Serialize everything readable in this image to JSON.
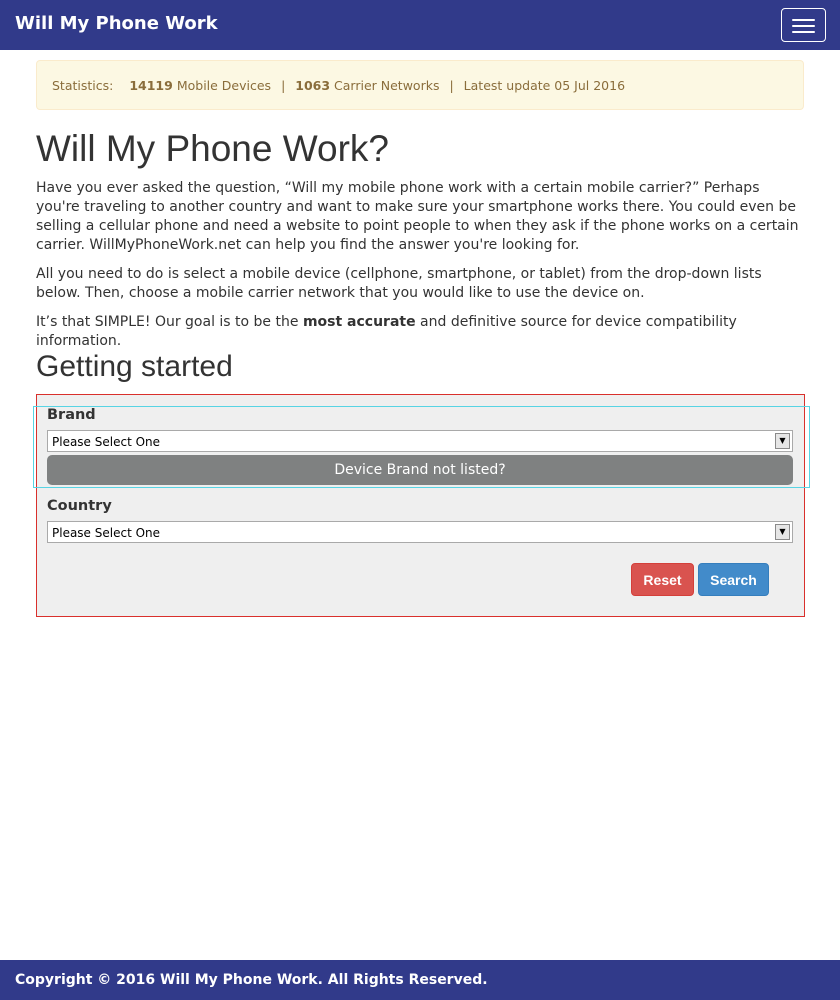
{
  "nav": {
    "brand": "Will My Phone Work"
  },
  "stats": {
    "label": "Statistics:",
    "devices_count": "14119",
    "devices_label": "Mobile Devices",
    "separator": "|",
    "networks_count": "1063",
    "networks_label": "Carrier Networks",
    "update_text": "Latest update 05 Jul 2016"
  },
  "main": {
    "title": "Will My Phone Work?",
    "paragraph1": "Have you ever asked the question, “Will my mobile phone work with a certain mobile carrier?” Perhaps you're traveling to another country and want to make sure your smartphone works there. You could even be selling a cellular phone and need a website to point people to when they ask if the phone works on a certain carrier. WillMyPhoneWork.net can help you find the answer you're looking for.",
    "paragraph2": "All you need to do is select a mobile device (cellphone, smartphone, or tablet) from the drop-down lists below. Then, choose a mobile carrier network that you would like to use the device on.",
    "paragraph3_before": "It’s that SIMPLE! Our goal is to be the ",
    "paragraph3_bold": "most accurate",
    "paragraph3_after": " and definitive source for device compatibility information.",
    "section_title": "Getting started"
  },
  "form": {
    "brand_label": "Brand",
    "brand_selected": "Please Select One",
    "brand_not_listed": "Device Brand not listed?",
    "country_label": "Country",
    "country_selected": "Please Select One",
    "reset_label": "Reset",
    "search_label": "Search"
  },
  "footer": {
    "text": "Copyright © 2016 Will My Phone Work. All Rights Reserved."
  },
  "colors": {
    "navbar": "#313a8a",
    "alert_bg": "#fcf8e3",
    "alert_text": "#8a6d3b",
    "panel_border": "#d9302c",
    "focus_outline": "#58d4e4",
    "reset": "#d9534f",
    "search": "#428bca"
  },
  "icons": {
    "menu": "hamburger-menu-icon",
    "select_arrow": "dropdown-arrow-icon"
  }
}
